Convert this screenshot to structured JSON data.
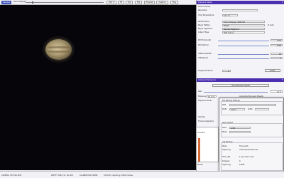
{
  "toolbar": {
    "camera_btn": "Camera",
    "zoom_label": "Zoom Display",
    "zoom_value": "100 %",
    "fit_btn": "Fit",
    "full_btn": "Full",
    "flip_btn": "Flip",
    "preview_btn": "Preview",
    "capture_btn": "Capture",
    "play_btn": "Play",
    "zoom_pct": 0.08
  },
  "control": {
    "title": "Camera Setup",
    "sensor": "Colour Sensor",
    "resolution_label": "Resolution",
    "chip_temp_label": "Chip Temperature",
    "chip_temp_value": "21.4 °C",
    "performance_label": "Performance",
    "performance_value": "Colour Display / RGB Out",
    "bayer_pattern_label": "Bayer Pattern",
    "bayer_pattern_value": "RGGB",
    "auto_label": "Auto",
    "bayer_algorithm_label": "Bayer Algorithm",
    "bayer_algorithm_value": "Nearest Neighbour",
    "output_type_label": "Output Type",
    "output_type_value": "RGB Output",
    "roi_h_label": "ROI Horizontal",
    "roi_h_value": "1440",
    "roi_v_label": "ROI Vertical",
    "roi_v_value": "1080",
    "usb_bw_label": "USB bandwidth",
    "usb_bw_value": "40",
    "usb_speed_label": "USB Speed",
    "usb_speed_value": "0",
    "dropped_label": "Dropped Frames",
    "dropped_value": "0",
    "reset_btn": "Reset"
  },
  "exposure": {
    "title": "Camera Exposure",
    "mode": "Short Exposure Mode",
    "gain_label": "Gain",
    "gain_value": "71 %",
    "exposure_label": "Exposure",
    "exposure_value": "10.0 ms",
    "exposure_limit": "Autoslide Exposure Presets",
    "exposure_scale_label": "Exposure Scale",
    "gamma_label": "Gamma",
    "frame_label": "Frame Integration"
  },
  "histogram": {
    "title": "Camera Histogram",
    "active_label": "Active",
    "bottom_label": "Shown"
  },
  "dialog": {
    "file_naming": "File Naming Settings",
    "path_label": "Path",
    "prefix_label": "Prefix",
    "prefix_value": "Jupiter",
    "suffix_label": "Suffix",
    "save_output": "Save Output",
    "save_label": "Save",
    "save_value": "Limit",
    "mode_label": "Mode",
    "log_window": "Log Window",
    "log_mode_label": "Mode",
    "log_mode_value": "Time Limit",
    "capturing_label": "Capturing",
    "capturing_value": "3 Minutes 00 Seconds",
    "time_left_label": "Time Left",
    "time_left_value": "1 min and 17 sec",
    "dropped_label": "Dropped",
    "dropped_value": "0",
    "capturing2_label": "Capturing",
    "capturing2_value": "12661",
    "start_btn": "Start",
    "stop_btn": "Stop",
    "close_btn": "Close"
  },
  "status": {
    "camera": "CAMERA: QHY-IIIC-5M4",
    "depth": "DEPTH: 8-Bit (1): 4K ADC",
    "calibration": "CALIBRATION: NONE",
    "state": "STATUS: Capturing (2641 frames"
  }
}
